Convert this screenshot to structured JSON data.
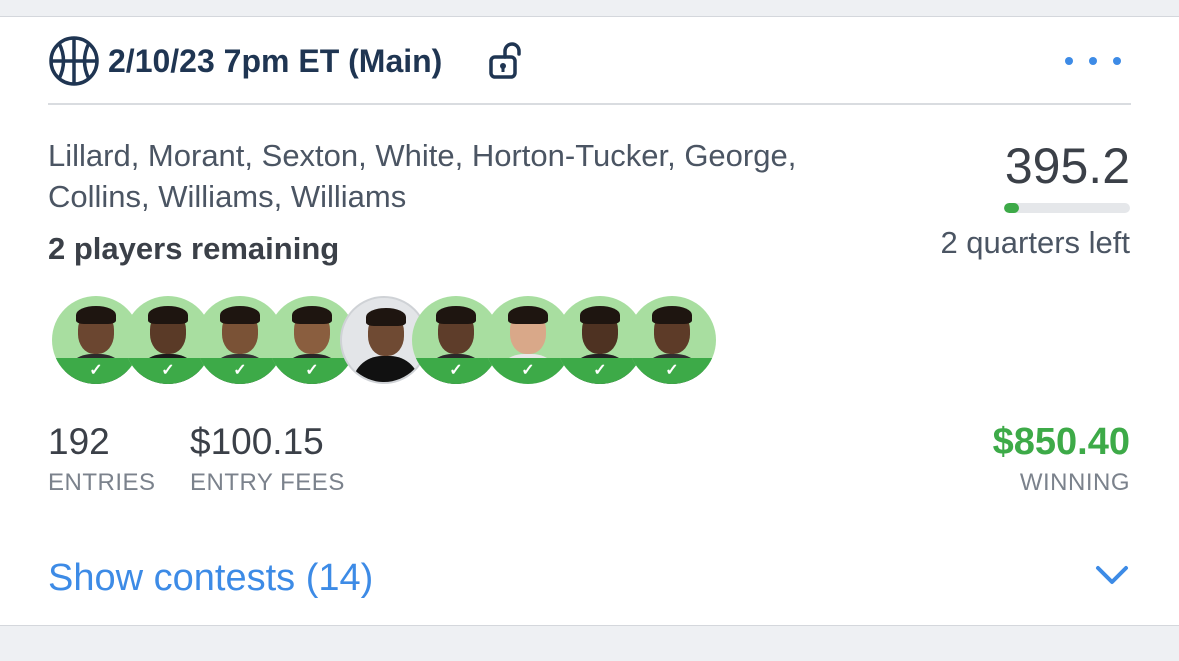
{
  "header": {
    "title": "2/10/23 7pm ET (Main)",
    "sport_icon": "basketball-icon",
    "lock_icon": "unlock-icon",
    "more_icon": "more-horizontal-icon"
  },
  "lineup": {
    "players_text": "Lillard, Morant, Sexton, White, Horton-Tucker, George, Collins, Williams, Williams",
    "remaining": "2 players remaining",
    "score": "395.2",
    "progress_fraction": 0.12,
    "time_left": "2 quarters left"
  },
  "avatars": [
    {
      "status": "done"
    },
    {
      "status": "done"
    },
    {
      "status": "done"
    },
    {
      "status": "done"
    },
    {
      "status": "live"
    },
    {
      "status": "done"
    },
    {
      "status": "done"
    },
    {
      "status": "done"
    },
    {
      "status": "done"
    }
  ],
  "stats": {
    "entries_value": "192",
    "entries_label": "ENTRIES",
    "fees_value": "$100.15",
    "fees_label": "ENTRY FEES",
    "winning_value": "$850.40",
    "winning_label": "WINNING"
  },
  "footer": {
    "show_contests": "Show contests (14)",
    "chevron_icon": "chevron-down-icon"
  },
  "colors": {
    "accent_blue": "#3d8be6",
    "win_green": "#3daa48",
    "title_navy": "#1f3552"
  }
}
